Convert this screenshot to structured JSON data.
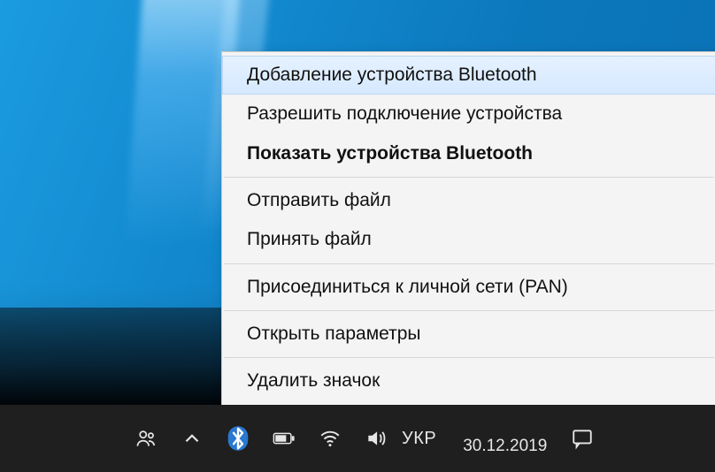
{
  "context_menu": {
    "items": [
      {
        "label": "Добавление устройства Bluetooth",
        "bold": false,
        "highlighted": true
      },
      {
        "label": "Разрешить подключение устройства",
        "bold": false,
        "highlighted": false
      },
      {
        "label": "Показать устройства Bluetooth",
        "bold": true,
        "highlighted": false
      },
      {
        "label": "Отправить файл",
        "bold": false,
        "highlighted": false
      },
      {
        "label": "Принять файл",
        "bold": false,
        "highlighted": false
      },
      {
        "label": "Присоединиться к личной сети (PAN)",
        "bold": false,
        "highlighted": false
      },
      {
        "label": "Открыть параметры",
        "bold": false,
        "highlighted": false
      },
      {
        "label": "Удалить значок",
        "bold": false,
        "highlighted": false
      }
    ],
    "separators_after": [
      2,
      4,
      5,
      6
    ]
  },
  "taskbar": {
    "tray_icons": [
      "people-icon",
      "chevron-up-icon",
      "bluetooth-icon",
      "battery-icon",
      "wifi-icon",
      "volume-icon"
    ],
    "language": "УКР",
    "time": "",
    "date": "30.12.2019",
    "action_center_icon": "notification-icon"
  }
}
